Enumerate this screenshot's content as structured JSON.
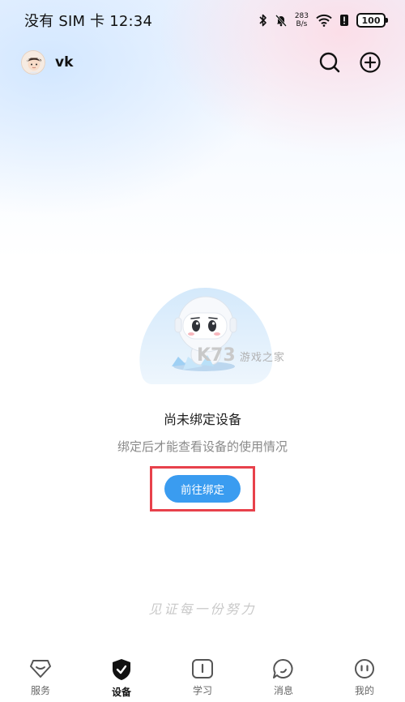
{
  "status_bar": {
    "carrier_time": "没有 SIM 卡 12:34",
    "speed_value": "283",
    "speed_unit": "B/s",
    "battery": "100"
  },
  "header": {
    "username": "vk",
    "icons": [
      "search-icon",
      "add-icon"
    ]
  },
  "empty_state": {
    "title": "尚未绑定设备",
    "description": "绑定后才能查看设备的使用情况",
    "button_label": "前往绑定"
  },
  "watermark": {
    "brand": "K73",
    "text": "游戏之家"
  },
  "slogan": "见证每一份努力",
  "tabs": [
    {
      "label": "服务",
      "icon": "service-icon",
      "active": false
    },
    {
      "label": "设备",
      "icon": "device-icon",
      "active": true
    },
    {
      "label": "学习",
      "icon": "learn-icon",
      "active": false
    },
    {
      "label": "消息",
      "icon": "message-icon",
      "active": false
    },
    {
      "label": "我的",
      "icon": "profile-icon",
      "active": false
    }
  ],
  "colors": {
    "accent": "#3a9cf0",
    "highlight_border": "#e8414b"
  }
}
